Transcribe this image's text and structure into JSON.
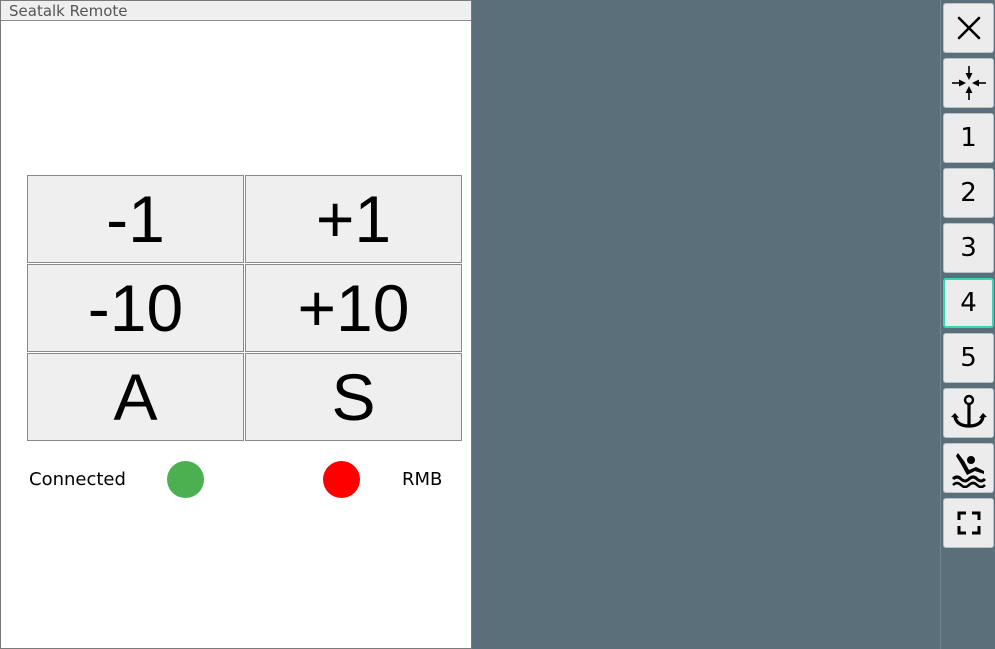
{
  "window": {
    "title": "Seatalk Remote"
  },
  "keypad": {
    "minus1": "-1",
    "plus1": "+1",
    "minus10": "-10",
    "plus10": "+10",
    "auto": "A",
    "standby": "S"
  },
  "status": {
    "connected_label": "Connected",
    "connected_color": "#4caf50",
    "rmb_label": "RMB",
    "rmb_color": "#ff0000"
  },
  "sidebar": {
    "close_icon": "close-icon",
    "center_icon": "compress-arrows-icon",
    "page1": "1",
    "page2": "2",
    "page3": "3",
    "page4": "4",
    "page5": "5",
    "selected_page": "4",
    "anchor_icon": "anchor-icon",
    "mob_icon": "man-overboard-icon",
    "fullscreen_icon": "fullscreen-icon",
    "active_color": "#3ad6b2"
  }
}
